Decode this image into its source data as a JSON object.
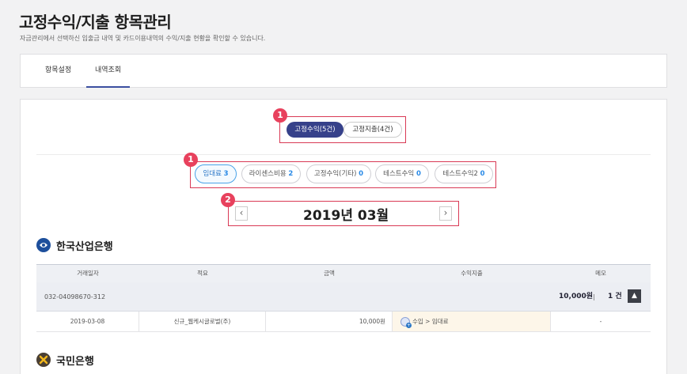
{
  "page": {
    "title": "고정수익/지출 항목관리",
    "description": "자금관리에서 선택하신 입출금 내역 및 카드이용내역의 수익/지출 현황을 확인할 수 있습니다."
  },
  "tabs": [
    {
      "label": "항목설정",
      "active": false
    },
    {
      "label": "내역조회",
      "active": true
    }
  ],
  "annotations": {
    "badge1": "1",
    "badge2": "2",
    "badge3": "1"
  },
  "type_toggle": [
    {
      "label": "고정수익(5건)",
      "selected": true
    },
    {
      "label": "고정지출(4건)",
      "selected": false
    }
  ],
  "categories": [
    {
      "name": "임대료",
      "count": "3",
      "selected": true
    },
    {
      "name": "라이센스비용",
      "count": "2",
      "selected": false
    },
    {
      "name": "고정수익(기타)",
      "count": "0",
      "selected": false
    },
    {
      "name": "테스트수익",
      "count": "0",
      "selected": false
    },
    {
      "name": "테스트수익2",
      "count": "0",
      "selected": false
    }
  ],
  "month_nav": {
    "label": "2019년 03월",
    "prev_icon": "chevron-left-icon",
    "next_icon": "chevron-right-icon"
  },
  "banks": [
    {
      "name": "한국산업은행",
      "logo_color": "#1d4f9c",
      "columns": [
        "거래일자",
        "적요",
        "금액",
        "수익지출",
        "메모"
      ],
      "account": {
        "number": "032-04098670-312",
        "total": "10,000원",
        "separator": "|",
        "count": "1 건"
      },
      "rows": [
        {
          "date": "2019-03-08",
          "summary": "신규_웹케시글로벌(주)",
          "amount": "10,000원",
          "flow": "수입 > 임대료",
          "memo": "-"
        }
      ]
    },
    {
      "name": "국민은행",
      "logo_color": "#4a3f33"
    }
  ],
  "colors": {
    "accent": "#36418a",
    "highlight": "#d93a55",
    "count": "#2a8ae6"
  }
}
